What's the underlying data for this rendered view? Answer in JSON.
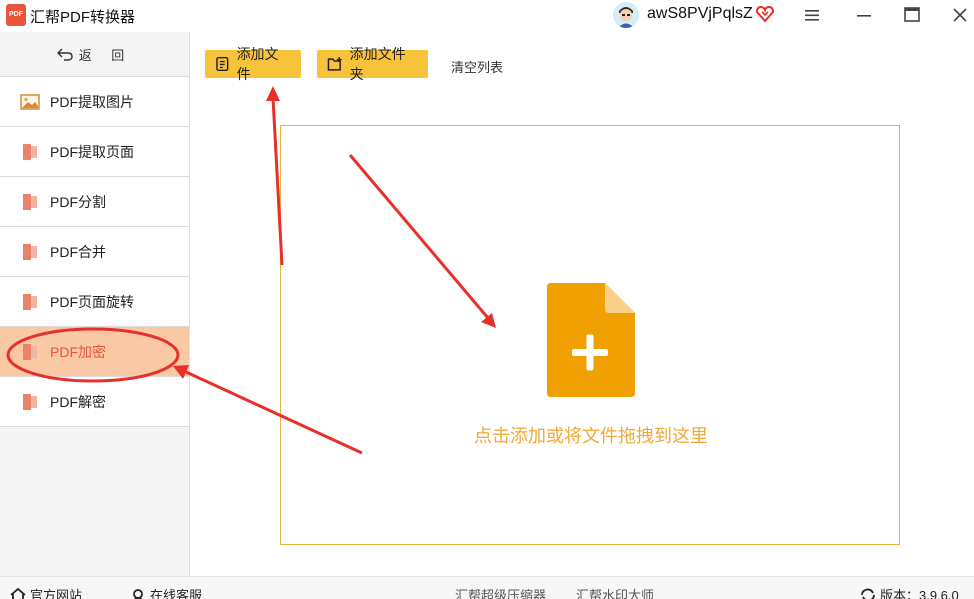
{
  "app": {
    "logo_text": "PDF",
    "title": "汇帮PDF转换器"
  },
  "user": {
    "name": "awS8PVjPqlsZ",
    "avatar_icon": "user-avatar-icon",
    "vip_icon": "heart-vip-icon"
  },
  "window_controls": [
    "menu-icon",
    "minimize-icon",
    "maximize-icon",
    "close-icon"
  ],
  "sidebar": {
    "back_label": "返 回",
    "items": [
      {
        "label": "PDF提取图片",
        "icon": "image-icon",
        "active": false
      },
      {
        "label": "PDF提取页面",
        "icon": "pdf-file-icon",
        "active": false
      },
      {
        "label": "PDF分割",
        "icon": "pdf-file-icon",
        "active": false
      },
      {
        "label": "PDF合并",
        "icon": "pdf-file-icon",
        "active": false
      },
      {
        "label": "PDF页面旋转",
        "icon": "pdf-file-icon",
        "active": false
      },
      {
        "label": "PDF加密",
        "icon": "pdf-file-icon",
        "active": true
      },
      {
        "label": "PDF解密",
        "icon": "pdf-file-icon",
        "active": false
      }
    ]
  },
  "toolbar": {
    "add_file_label": "添加文件",
    "add_folder_label": "添加文件夹",
    "clear_list_label": "清空列表"
  },
  "dropzone": {
    "hint": "点击添加或将文件拖拽到这里",
    "icon": "file-plus-icon"
  },
  "statusbar": {
    "website_label": "官方网站",
    "support_label": "在线客服",
    "compressor_label": "汇帮超级压缩器",
    "watermark_label": "汇帮水印大师",
    "version_label": "版本：3.9.6.0"
  },
  "colors": {
    "accent_yellow": "#f7c33a",
    "active_item_bg": "#f9c9a6",
    "active_item_text": "#e8553b",
    "drop_icon": "#f0a000",
    "drop_hint": "#f0a836",
    "annotation_red": "#e8302a"
  }
}
